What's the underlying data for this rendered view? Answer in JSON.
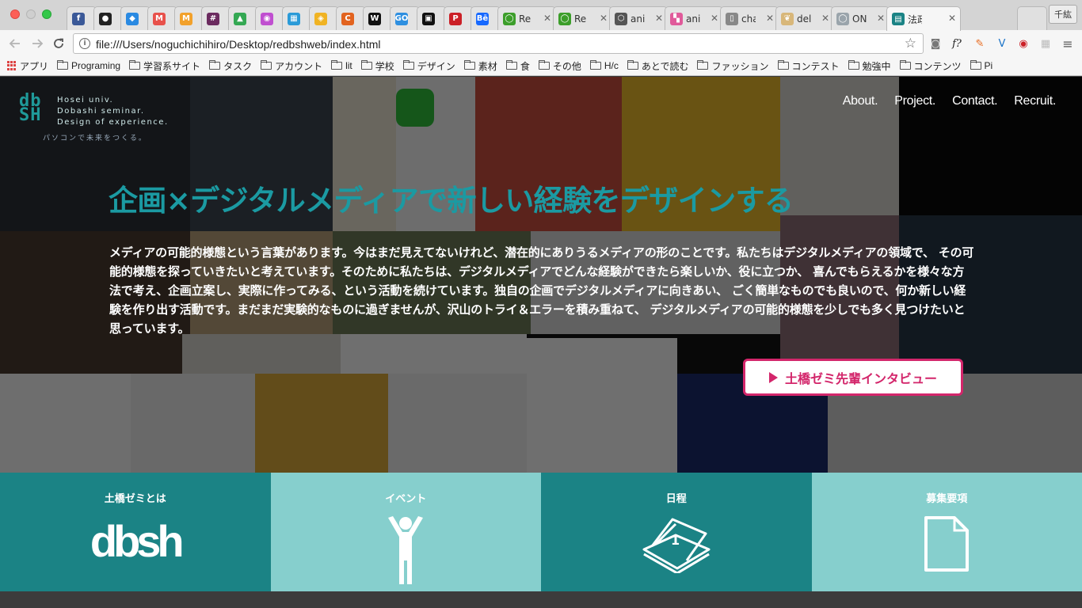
{
  "browser": {
    "tabs": [
      {
        "favicon": "facebook-icon",
        "color": "#3b5998",
        "glyph": "f",
        "label": ""
      },
      {
        "favicon": "github-icon",
        "color": "#222222",
        "glyph": "●",
        "label": ""
      },
      {
        "favicon": "dropbox-icon",
        "color": "#2a8ae2",
        "glyph": "◆",
        "label": ""
      },
      {
        "favicon": "gmail-icon",
        "color": "#e8514b",
        "glyph": "M",
        "label": ""
      },
      {
        "favicon": "gmail-icon",
        "color": "#f2a12b",
        "glyph": "M",
        "label": ""
      },
      {
        "favicon": "slack-icon",
        "color": "#6b2b5f",
        "glyph": "#",
        "label": ""
      },
      {
        "favicon": "drive-icon",
        "color": "#34a853",
        "glyph": "▲",
        "label": ""
      },
      {
        "favicon": "color-wheel-icon",
        "color": "#c04fd0",
        "glyph": "◉",
        "label": ""
      },
      {
        "favicon": "grid-icon",
        "color": "#2b9bd8",
        "glyph": "▦",
        "label": ""
      },
      {
        "favicon": "badge-icon",
        "color": "#f0b323",
        "glyph": "◈",
        "label": ""
      },
      {
        "favicon": "c-icon",
        "color": "#e2631f",
        "glyph": "C",
        "label": ""
      },
      {
        "favicon": "w-icon",
        "color": "#111111",
        "glyph": "W",
        "label": ""
      },
      {
        "favicon": "go-icon",
        "color": "#2e8fe0",
        "glyph": "GO",
        "label": ""
      },
      {
        "favicon": "box-icon",
        "color": "#111111",
        "glyph": "▣",
        "label": ""
      },
      {
        "favicon": "pinterest-icon",
        "color": "#cb2027",
        "glyph": "P",
        "label": ""
      },
      {
        "favicon": "behance-icon",
        "color": "#1769ff",
        "glyph": "Bē",
        "label": ""
      },
      {
        "favicon": "green-circle-icon",
        "color": "#3c9e2a",
        "glyph": "◯",
        "label": "Re"
      },
      {
        "favicon": "green-circle-icon",
        "color": "#3c9e2a",
        "glyph": "◯",
        "label": "Re"
      },
      {
        "favicon": "hex-icon",
        "color": "#555555",
        "glyph": "⬡",
        "label": "ani"
      },
      {
        "favicon": "colorful-icon",
        "color": "#e05a9a",
        "glyph": "▚",
        "label": "ani"
      },
      {
        "favicon": "document-icon",
        "color": "#888888",
        "glyph": "▯",
        "label": "cha"
      },
      {
        "favicon": "feather-icon",
        "color": "#d8b77a",
        "glyph": "❦",
        "label": "del"
      },
      {
        "favicon": "ring-icon",
        "color": "#9aa4ab",
        "glyph": "◯",
        "label": "ON"
      },
      {
        "favicon": "dbsh-icon",
        "color": "#1b8385",
        "glyph": "▤",
        "label": "法政"
      }
    ],
    "active_tab_index": 23,
    "profile_label": "千紘",
    "url": "file:///Users/noguchichihiro/Desktop/redbshweb/index.html",
    "bookmarks": [
      {
        "type": "apps",
        "label": "アプリ"
      },
      {
        "type": "folder",
        "label": "Programing"
      },
      {
        "type": "folder",
        "label": "学習系サイト"
      },
      {
        "type": "folder",
        "label": "タスク"
      },
      {
        "type": "folder",
        "label": "アカウント"
      },
      {
        "type": "folder",
        "label": "lit"
      },
      {
        "type": "folder",
        "label": "学校"
      },
      {
        "type": "folder",
        "label": "デザイン"
      },
      {
        "type": "folder",
        "label": "素材"
      },
      {
        "type": "folder",
        "label": "食"
      },
      {
        "type": "folder",
        "label": "その他"
      },
      {
        "type": "folder",
        "label": "H/c"
      },
      {
        "type": "folder",
        "label": "あとで読む"
      },
      {
        "type": "folder",
        "label": "ファッション"
      },
      {
        "type": "folder",
        "label": "コンテスト"
      },
      {
        "type": "folder",
        "label": "勉強中"
      },
      {
        "type": "folder",
        "label": "コンテンツ"
      },
      {
        "type": "folder",
        "label": "Pi"
      }
    ]
  },
  "site": {
    "logo": {
      "mark": "db\nSH",
      "lines": [
        "Hosei univ.",
        "Dobashi seminar.",
        "Design of experience."
      ],
      "tagline": "パソコンで未来をつくる。"
    },
    "nav": [
      "About.",
      "Project.",
      "Contact.",
      "Recruit."
    ],
    "headline": "企画×デジタルメディアで新しい経験をデザインする",
    "lead": "メディアの可能的様態という言葉があります。今はまだ見えてないけれど、潜在的にありうるメディアの形のことです。私たちはデジタルメディアの領域で、 その可能的様態を探っていきたいと考えています。そのために私たちは、デジタルメディアでどんな経験ができたら楽しいか、役に立つか、 喜んでもらえるかを様々な方法で考え、企画立案し、実際に作ってみる、という活動を続けています。独自の企画でデジタルメディアに向きあい、 ごく簡単なものでも良いので、何か新しい経験を作り出す活動です。まだまだ実験的なものに過ぎませんが、沢山のトライ＆エラーを積み重ねて、 デジタルメディアの可能的様態を少しでも多く見つけたいと思っています。",
    "interview_button": "土橋ゼミ先輩インタビュー",
    "features": [
      {
        "title": "土橋ゼミとは",
        "icon": "dbsh-logo-icon",
        "icon_text": "dbsh",
        "theme": "dark"
      },
      {
        "title": "イベント",
        "icon": "person-icon",
        "icon_text": "",
        "theme": "light"
      },
      {
        "title": "日程",
        "icon": "calendar-icon",
        "icon_text": "1",
        "theme": "dark"
      },
      {
        "title": "募集要項",
        "icon": "document-icon",
        "icon_text": "",
        "theme": "light"
      }
    ],
    "colors": {
      "accent": "#1b9aa2",
      "feature_dark": "#1b8385",
      "feature_light": "#86cfcd",
      "button": "#d3266b"
    }
  }
}
